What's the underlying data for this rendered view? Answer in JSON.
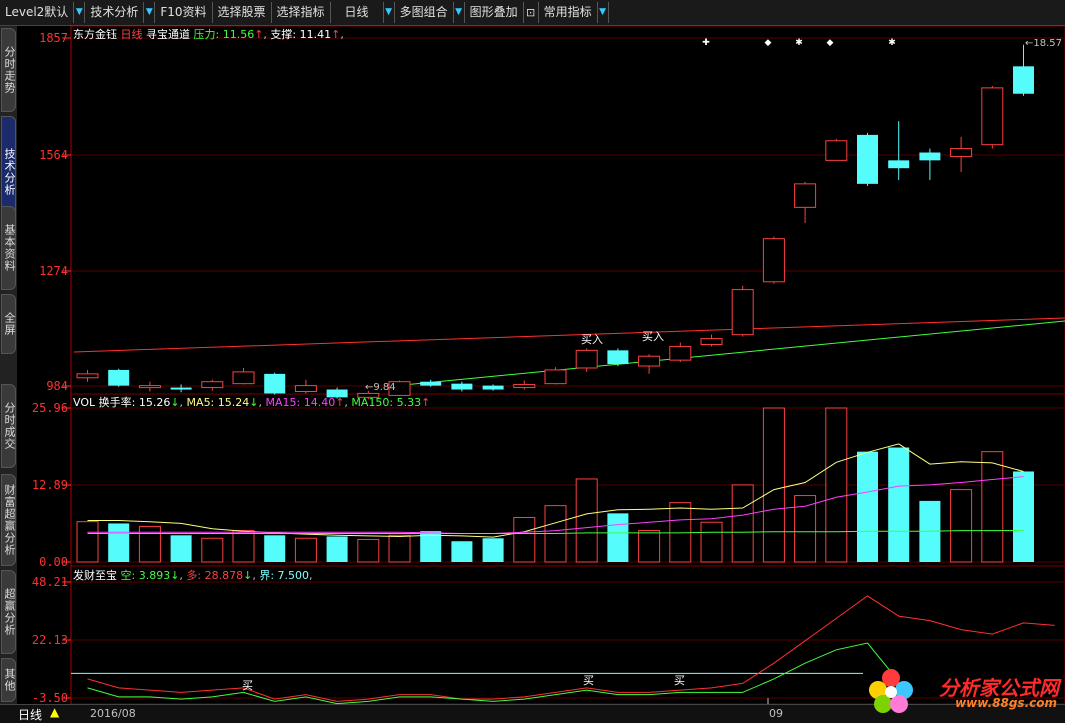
{
  "toolbar": {
    "items": [
      "Level2默认",
      "技术分析",
      "F10资料",
      "选择股票",
      "选择指标",
      "日线",
      "多图组合",
      "图形叠加",
      "常用指标"
    ]
  },
  "sidebar": {
    "tabs": [
      "分时走势",
      "技术分析",
      "基本资料",
      "全屏",
      "分时成交",
      "财富超赢分析",
      "超赢分析",
      "其他"
    ]
  },
  "main_header": {
    "stock": "东方金钰",
    "period": "日线",
    "indicator": "寻宝通道",
    "pressure": "压力: 11.56",
    "support": "支撑: 11.41"
  },
  "vol_header": {
    "name": "VOL",
    "turnover": "换手率: 15.26",
    "ma5": "MA5: 15.24",
    "ma15": "MA15: 14.40",
    "ma150": "MA150: 5.33"
  },
  "ind_header": {
    "name": "发财至宝",
    "kong": "空: 3.893",
    "duo": "多: 28.878",
    "jie": "界: 7.500"
  },
  "axes": {
    "price_ticks": [
      "1857",
      "1564",
      "1274",
      "984"
    ],
    "vol_ticks": [
      "25.96",
      "12.89",
      "0.00"
    ],
    "ind_ticks": [
      "48.21",
      "22.13",
      "-3.50"
    ]
  },
  "annotations": {
    "high": "18.57",
    "low": "9.84",
    "buy1": "买入",
    "buy2": "买入",
    "buy_small": "买"
  },
  "bottom": {
    "period": "日线",
    "date1": "2016/08",
    "date2": "09"
  },
  "watermark": {
    "text": "分析家公式网",
    "url": "www.88gs.com"
  },
  "chart_data": {
    "type": "candlestick",
    "price_axis": [
      9.84,
      18.57
    ],
    "candles": [
      {
        "o": 10.05,
        "c": 10.15,
        "h": 10.25,
        "l": 9.95,
        "up": true
      },
      {
        "o": 10.25,
        "c": 9.85,
        "h": 10.28,
        "l": 9.82,
        "up": false
      },
      {
        "o": 9.8,
        "c": 9.85,
        "h": 9.95,
        "l": 9.7,
        "up": true
      },
      {
        "o": 9.8,
        "c": 9.75,
        "h": 9.88,
        "l": 9.68,
        "up": false
      },
      {
        "o": 9.8,
        "c": 9.95,
        "h": 10.0,
        "l": 9.72,
        "up": true
      },
      {
        "o": 9.9,
        "c": 10.2,
        "h": 10.3,
        "l": 9.88,
        "up": true
      },
      {
        "o": 10.15,
        "c": 9.65,
        "h": 10.18,
        "l": 9.62,
        "up": false
      },
      {
        "o": 9.7,
        "c": 9.85,
        "h": 10.0,
        "l": 9.65,
        "up": true
      },
      {
        "o": 9.75,
        "c": 9.55,
        "h": 9.8,
        "l": 9.52,
        "up": false
      },
      {
        "o": 9.55,
        "c": 9.65,
        "h": 9.72,
        "l": 9.5,
        "up": true
      },
      {
        "o": 9.6,
        "c": 9.95,
        "h": 9.98,
        "l": 9.58,
        "up": true
      },
      {
        "o": 9.95,
        "c": 9.85,
        "h": 10.0,
        "l": 9.82,
        "up": false
      },
      {
        "o": 9.9,
        "c": 9.75,
        "h": 9.95,
        "l": 9.7,
        "up": false
      },
      {
        "o": 9.85,
        "c": 9.75,
        "h": 9.88,
        "l": 9.72,
        "up": false
      },
      {
        "o": 9.8,
        "c": 9.88,
        "h": 9.98,
        "l": 9.75,
        "up": true
      },
      {
        "o": 9.9,
        "c": 10.25,
        "h": 10.32,
        "l": 9.88,
        "up": true
      },
      {
        "o": 10.3,
        "c": 10.75,
        "h": 10.8,
        "l": 10.2,
        "up": true
      },
      {
        "o": 10.75,
        "c": 10.4,
        "h": 10.8,
        "l": 10.35,
        "up": false
      },
      {
        "o": 10.35,
        "c": 10.6,
        "h": 10.65,
        "l": 10.15,
        "up": true
      },
      {
        "o": 10.5,
        "c": 10.85,
        "h": 10.95,
        "l": 10.45,
        "up": true
      },
      {
        "o": 10.9,
        "c": 11.05,
        "h": 11.15,
        "l": 10.85,
        "up": true
      },
      {
        "o": 11.15,
        "c": 12.3,
        "h": 12.4,
        "l": 11.1,
        "up": true
      },
      {
        "o": 12.5,
        "c": 13.6,
        "h": 13.65,
        "l": 12.45,
        "up": true
      },
      {
        "o": 14.4,
        "c": 15.0,
        "h": 15.05,
        "l": 14.0,
        "up": true
      },
      {
        "o": 15.6,
        "c": 16.1,
        "h": 16.15,
        "l": 15.6,
        "up": true
      },
      {
        "o": 16.25,
        "c": 15.0,
        "h": 16.3,
        "l": 14.95,
        "up": false
      },
      {
        "o": 15.6,
        "c": 15.4,
        "h": 16.6,
        "l": 15.1,
        "up": false
      },
      {
        "o": 15.8,
        "c": 15.6,
        "h": 15.9,
        "l": 15.1,
        "up": false
      },
      {
        "o": 15.7,
        "c": 15.9,
        "h": 16.2,
        "l": 15.3,
        "up": true
      },
      {
        "o": 16.0,
        "c": 17.45,
        "h": 17.5,
        "l": 15.9,
        "up": true
      },
      {
        "o": 18.0,
        "c": 17.3,
        "h": 18.55,
        "l": 17.25,
        "up": false
      }
    ],
    "volume": [
      6.8,
      6.5,
      6.0,
      4.5,
      4.0,
      5.3,
      4.5,
      4.0,
      4.3,
      3.8,
      4.5,
      5.2,
      3.5,
      4.0,
      7.5,
      9.5,
      14.0,
      8.2,
      5.3,
      10.0,
      6.7,
      13.0,
      25.96,
      11.2,
      25.96,
      18.6,
      19.3,
      10.3,
      12.2,
      18.6,
      15.26
    ],
    "ma5": [
      7,
      7,
      6.8,
      6.5,
      5.6,
      5.2,
      4.9,
      4.7,
      4.5,
      4.4,
      4.3,
      4.5,
      4.4,
      4.2,
      5.1,
      6.6,
      8.1,
      8.8,
      8.9,
      9.1,
      8.9,
      9.1,
      12.2,
      13.4,
      16.8,
      18.5,
      19.9,
      16.5,
      16.9,
      16.7,
      15.26
    ],
    "ma15": [
      5,
      5,
      5,
      5,
      5,
      5,
      5,
      5,
      5,
      5,
      5,
      4.9,
      4.8,
      4.8,
      5,
      5.3,
      5.8,
      6.3,
      6.7,
      7.1,
      7.3,
      7.9,
      8.9,
      9.4,
      10.9,
      11.8,
      12.8,
      13,
      13.4,
      13.9,
      14.4
    ],
    "ma150": [
      4.8,
      4.8,
      4.8,
      4.8,
      4.8,
      4.8,
      4.8,
      4.8,
      4.8,
      4.8,
      4.8,
      4.8,
      4.8,
      4.8,
      4.8,
      4.8,
      4.9,
      4.9,
      4.9,
      4.9,
      5,
      5,
      5.1,
      5.1,
      5.1,
      5.2,
      5.2,
      5.2,
      5.3,
      5.3,
      5.33
    ],
    "duo": [
      5,
      1,
      0,
      -1,
      0,
      1,
      -4,
      -2,
      -5,
      -4,
      -2,
      -2,
      -4,
      -4,
      -3,
      -1,
      1,
      -1,
      -1,
      0,
      1,
      3,
      12,
      22,
      32,
      42,
      33,
      31,
      27,
      25,
      30,
      28.878
    ],
    "kong": [
      1,
      -3,
      -3,
      -4,
      -3,
      -1,
      -5,
      -3,
      -6,
      -5,
      -3,
      -3,
      -4,
      -5,
      -4,
      -2,
      0,
      -2,
      -2,
      -1,
      -1,
      -1,
      5,
      12,
      18,
      21,
      3.893
    ],
    "jie": 7.5
  }
}
